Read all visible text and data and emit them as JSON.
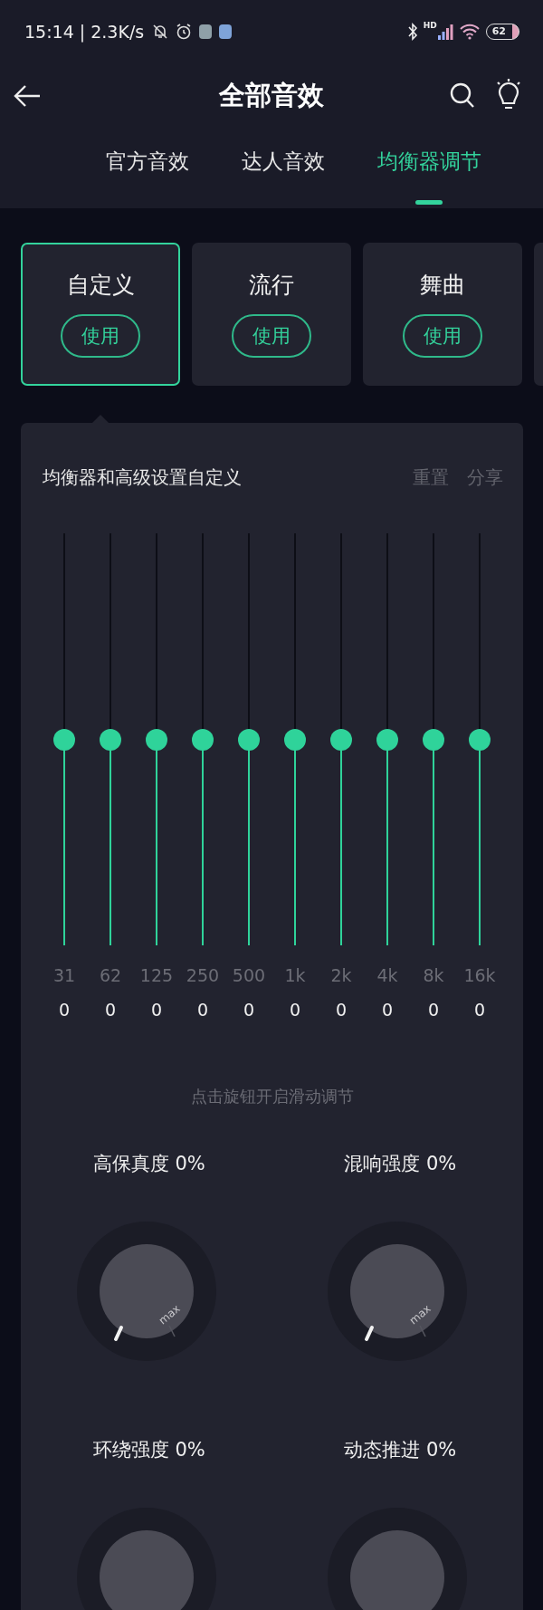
{
  "status_bar": {
    "time": "15:14 | 2.3K/s",
    "network_label": "HD",
    "battery": "62"
  },
  "header": {
    "title": "全部音效"
  },
  "tabs": [
    {
      "label": "官方音效",
      "selected": false
    },
    {
      "label": "达人音效",
      "selected": false
    },
    {
      "label": "均衡器调节",
      "selected": true
    }
  ],
  "presets": [
    {
      "name": "自定义",
      "button": "使用",
      "selected": true
    },
    {
      "name": "流行",
      "button": "使用",
      "selected": false
    },
    {
      "name": "舞曲",
      "button": "使用",
      "selected": false
    }
  ],
  "equalizer": {
    "title": "均衡器和高级设置自定义",
    "actions": [
      "重置",
      "分享"
    ],
    "bands": [
      {
        "frequency": "31",
        "value": "0",
        "level": 0.5
      },
      {
        "frequency": "62",
        "value": "0",
        "level": 0.5
      },
      {
        "frequency": "125",
        "value": "0",
        "level": 0.5
      },
      {
        "frequency": "250",
        "value": "0",
        "level": 0.5
      },
      {
        "frequency": "500",
        "value": "0",
        "level": 0.5
      },
      {
        "frequency": "1k",
        "value": "0",
        "level": 0.5
      },
      {
        "frequency": "2k",
        "value": "0",
        "level": 0.5
      },
      {
        "frequency": "4k",
        "value": "0",
        "level": 0.5
      },
      {
        "frequency": "8k",
        "value": "0",
        "level": 0.5
      },
      {
        "frequency": "16k",
        "value": "0",
        "level": 0.5
      }
    ],
    "hint": "点击旋钮开启滑动调节",
    "knobs": [
      {
        "label": "高保真度 0%",
        "max_label": "max"
      },
      {
        "label": "混响强度 0%",
        "max_label": "max"
      },
      {
        "label": "环绕强度 0%"
      },
      {
        "label": "动态推进 0%"
      }
    ]
  }
}
